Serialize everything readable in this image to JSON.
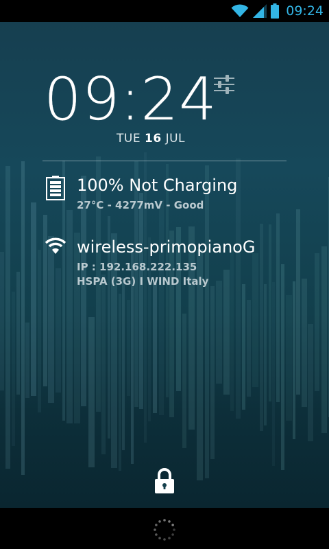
{
  "status_bar": {
    "time": "09:24",
    "icons": [
      "wifi-icon",
      "signal-icon",
      "battery-icon"
    ],
    "accent_color": "#33b5e5"
  },
  "lockscreen": {
    "clock": "09:24",
    "date": {
      "weekday": "TUE",
      "day": "16",
      "month": "JUL"
    },
    "battery": {
      "icon": "battery-full-icon",
      "title": "100% Not Charging",
      "detail": "27°C - 4277mV - Good"
    },
    "network": {
      "icon": "wifi-icon",
      "ssid": "wireless-primopianoG",
      "ip": "IP : 192.168.222.135",
      "carrier": "HSPA (3G) I WIND Italy"
    },
    "settings_icon": "settings-sliders-icon",
    "unlock_icon": "lock-icon"
  },
  "nav_bar": {
    "icon": "loading-spinner-icon"
  }
}
